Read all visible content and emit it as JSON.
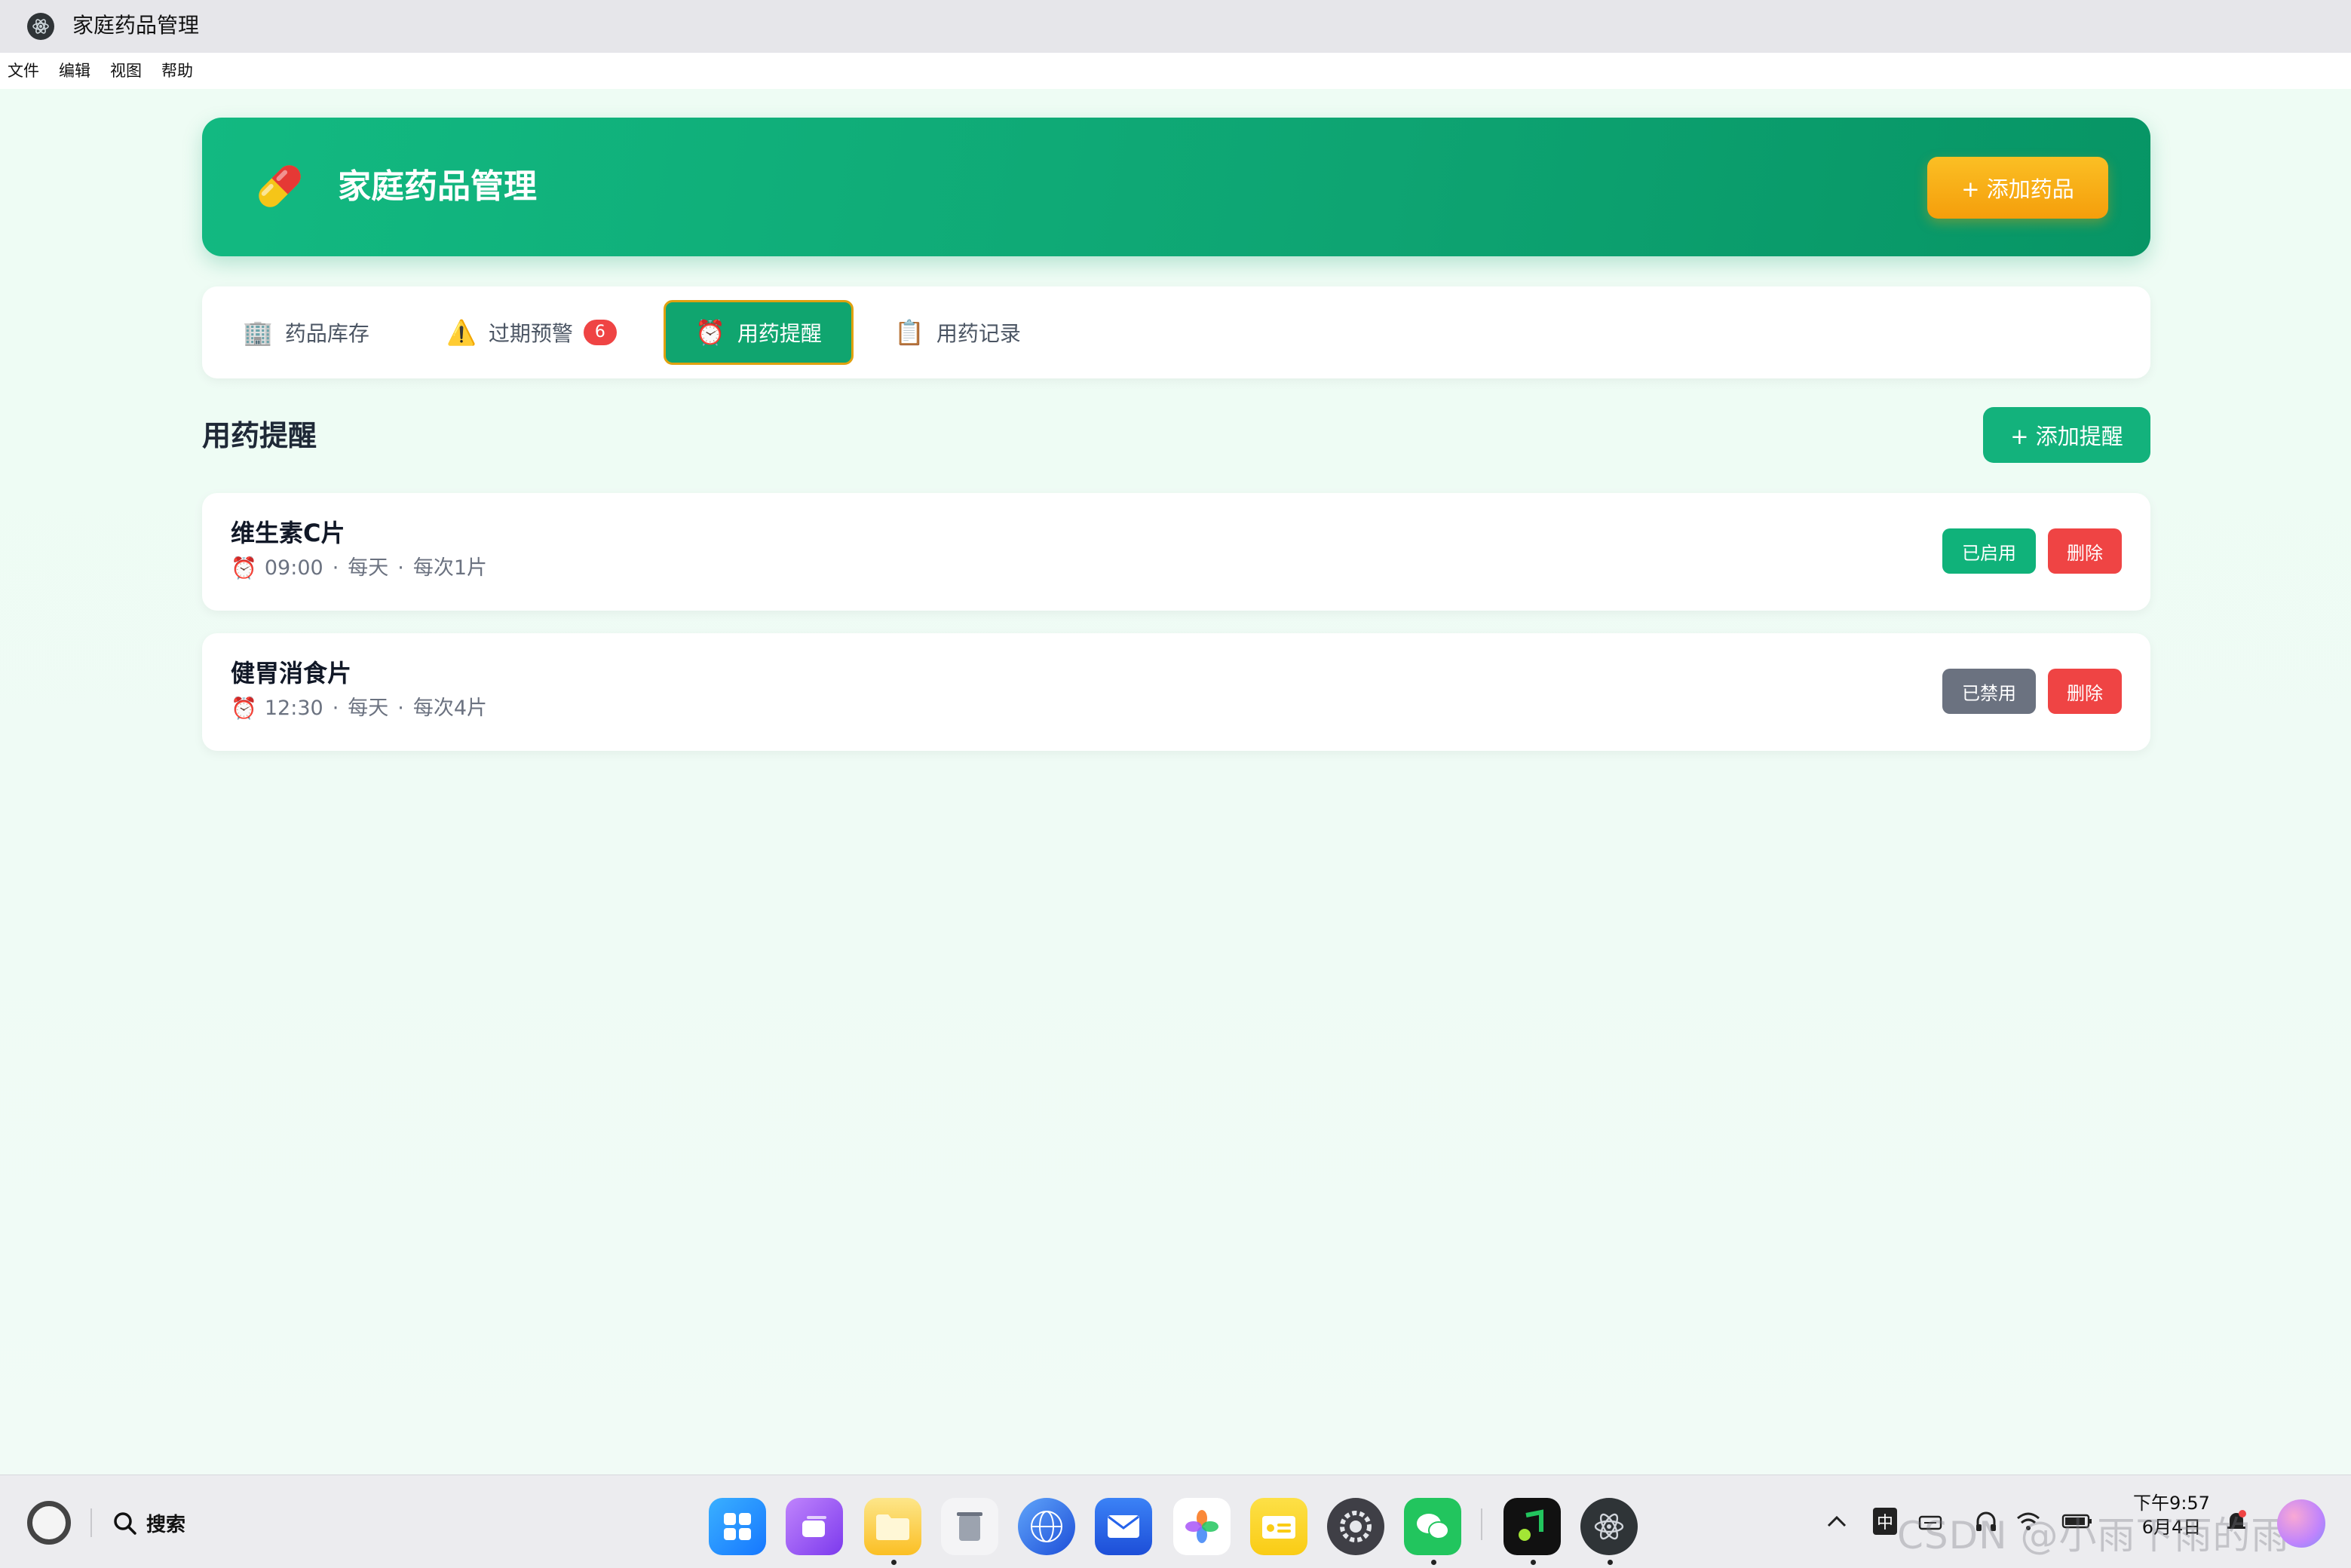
{
  "window": {
    "title": "家庭药品管理"
  },
  "menubar": {
    "items": [
      "文件",
      "编辑",
      "视图",
      "帮助"
    ]
  },
  "header": {
    "title": "家庭药品管理",
    "add_button": "+ 添加药品",
    "icon": "pill-icon"
  },
  "tabs": {
    "inventory": {
      "label": "药品库存",
      "icon": "building-icon"
    },
    "expiry": {
      "label": "过期预警",
      "icon": "warning-icon",
      "badge": "6"
    },
    "reminder": {
      "label": "用药提醒",
      "icon": "alarm-clock-icon",
      "active": true
    },
    "records": {
      "label": "用药记录",
      "icon": "clipboard-icon"
    }
  },
  "section": {
    "title": "用药提醒",
    "add_button": "+ 添加提醒"
  },
  "reminders": [
    {
      "name": "维生素C片",
      "time": "09:00",
      "frequency": "每天",
      "dosage": "每次1片",
      "status": "已启用",
      "delete": "删除"
    },
    {
      "name": "健胃消食片",
      "time": "12:30",
      "frequency": "每天",
      "dosage": "每次4片",
      "status": "已禁用",
      "delete": "删除"
    }
  ],
  "taskbar": {
    "search_label": "搜索",
    "ime": "中",
    "time": "下午9:57",
    "date": "6月4日",
    "watermark": "CSDN @小雨下雨的雨"
  },
  "colors": {
    "primary_green": "#10b981",
    "accent_amber": "#f59e0b",
    "danger_red": "#ef4444",
    "disabled_gray": "#6b7280"
  }
}
